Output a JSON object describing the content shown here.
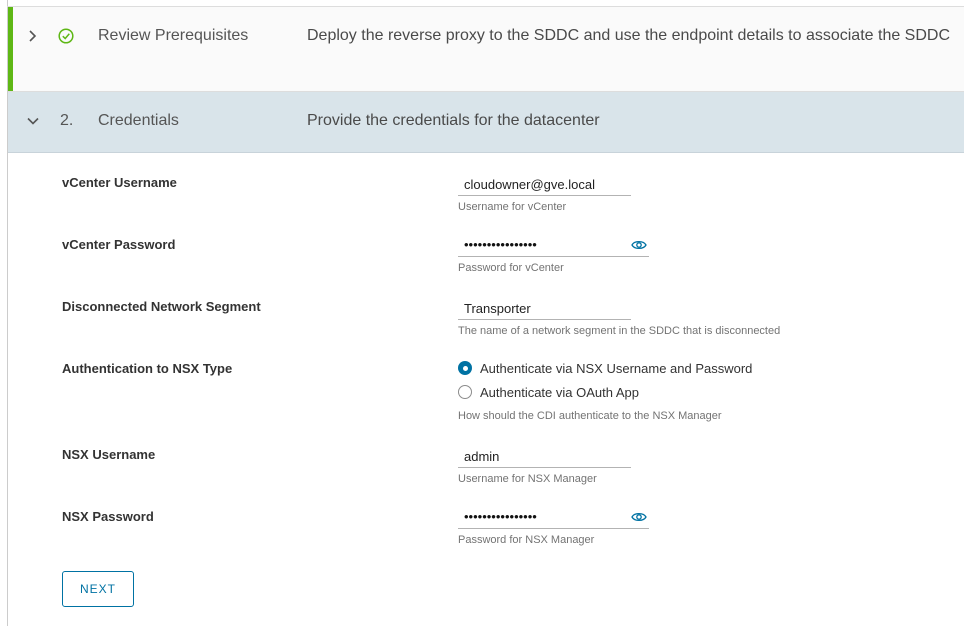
{
  "steps": [
    {
      "number": "",
      "title": "Review Prerequisites",
      "description": "Deploy the reverse proxy to the SDDC and use the endpoint details to associate the SDDC",
      "status": "complete",
      "expanded": false
    },
    {
      "number": "2.",
      "title": "Credentials",
      "description": "Provide the credentials for the datacenter",
      "status": "active",
      "expanded": true
    }
  ],
  "form": {
    "vcenter_username": {
      "label": "vCenter Username",
      "value": "cloudowner@gve.local",
      "helper": "Username for vCenter"
    },
    "vcenter_password": {
      "label": "vCenter Password",
      "masked_value": "••••••••••••••••",
      "helper": "Password for vCenter"
    },
    "network_segment": {
      "label": "Disconnected Network Segment",
      "value": "Transporter",
      "helper": "The name of a network segment in the SDDC that is disconnected"
    },
    "nsx_auth_type": {
      "label": "Authentication to NSX Type",
      "options": [
        {
          "label": "Authenticate via NSX Username and Password",
          "selected": true
        },
        {
          "label": "Authenticate via OAuth App",
          "selected": false
        }
      ],
      "helper": "How should the CDI authenticate to the NSX Manager"
    },
    "nsx_username": {
      "label": "NSX Username",
      "value": "admin",
      "helper": "Username for NSX Manager"
    },
    "nsx_password": {
      "label": "NSX Password",
      "masked_value": "••••••••••••••••",
      "helper": "Password for NSX Manager"
    }
  },
  "next_label": "NEXT",
  "colors": {
    "accent": "#0072a3",
    "complete_green": "#5eb715",
    "active_step_bg": "#d9e4ea"
  }
}
